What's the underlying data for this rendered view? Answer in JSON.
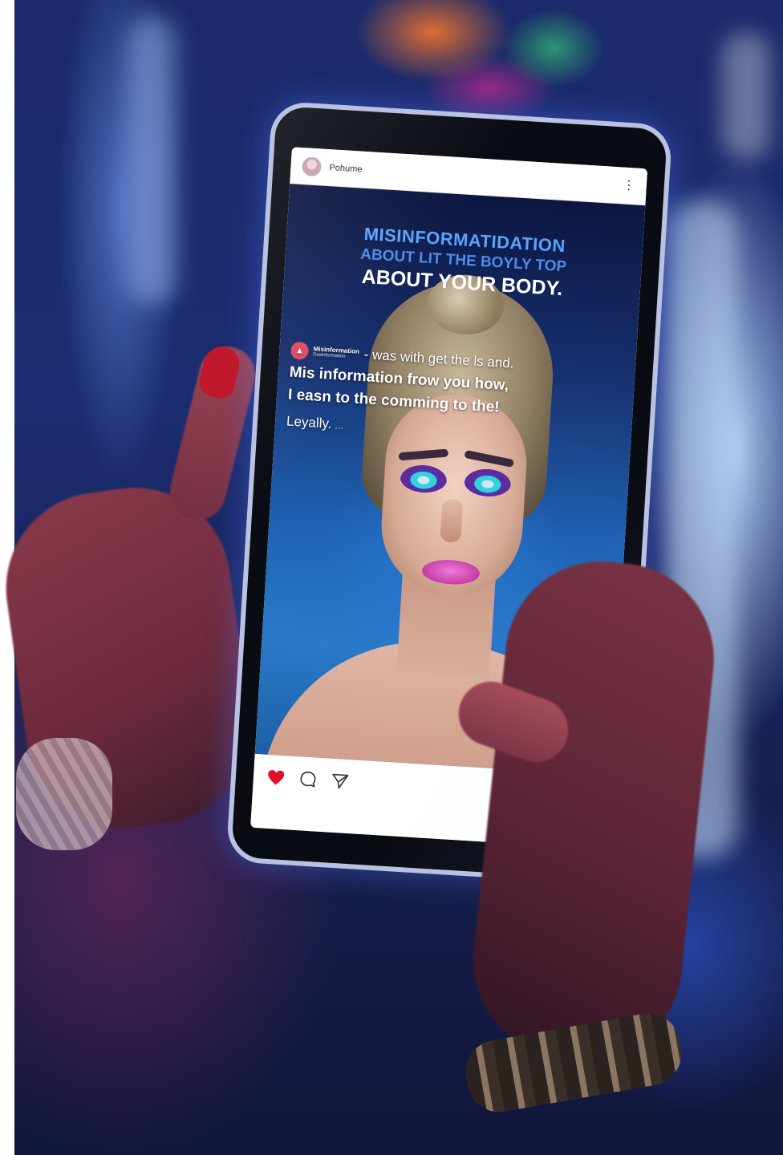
{
  "post": {
    "username": "Pohume",
    "headline": {
      "line1": "MISINFORMATIDATION",
      "line2": "ABOUT LIT THE BOYLY TOP",
      "line3": "ABOUT YOUR BODY."
    },
    "caption": {
      "account_name": "Misinformation",
      "account_subtitle": "Dasinformation",
      "first_line": "- was with get the ls and.",
      "line2": "Mis information frow you how,",
      "line3": "I easn to the comming to the!",
      "last_line": "Leyally.",
      "more": "…"
    }
  },
  "icons": {
    "more": "more-vertical-icon",
    "like": "heart-icon",
    "comment": "comment-icon",
    "share": "send-icon"
  },
  "colors": {
    "like_red": "#e0102a",
    "headline_blue": "#5aa4ff",
    "lip_pink": "#e05ac8",
    "eye_teal": "#2fd3e2"
  }
}
